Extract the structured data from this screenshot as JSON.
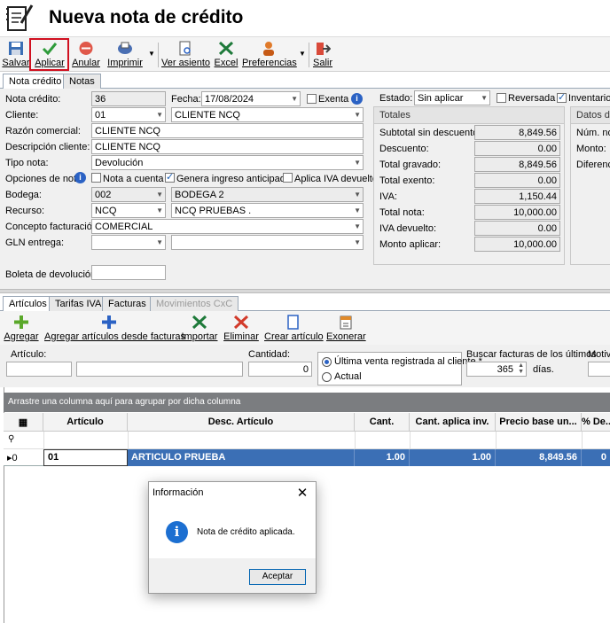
{
  "header": {
    "title": "Nueva nota de crédito",
    "icon": "notebook-edit-icon"
  },
  "toolbar": {
    "salvar": "Salvar",
    "aplicar": "Aplicar",
    "anular": "Anular",
    "imprimir": "Imprimir",
    "ver_asiento": "Ver asiento",
    "excel": "Excel",
    "preferencias": "Preferencias",
    "salir": "Salir"
  },
  "tabs": [
    "Nota crédito",
    "Notas"
  ],
  "form": {
    "nota_credito_label": "Nota crédito:",
    "nota_credito": "36",
    "fecha_label": "Fecha:",
    "fecha": "17/08/2024",
    "exenta_label": "Exenta",
    "cliente_label": "Cliente:",
    "cliente_code": "01",
    "cliente_name": "CLIENTE NCQ",
    "razon_label": "Razón comercial:",
    "razon": "CLIENTE NCQ",
    "descripcion_label": "Descripción cliente:",
    "descripcion": "CLIENTE NCQ",
    "tipo_label": "Tipo nota:",
    "tipo": "Devolución",
    "opciones_label": "Opciones de nota:",
    "nota_cuenta_label": "Nota a cuenta",
    "genera_label": "Genera ingreso anticipado",
    "aplica_iva_label": "Aplica IVA devuelto",
    "bodega_label": "Bodega:",
    "bodega_code": "002",
    "bodega_name": "BODEGA 2",
    "recurso_label": "Recurso:",
    "recurso_code": "NCQ",
    "recurso_name": "NCQ PRUEBAS .",
    "concepto_label": "Concepto facturación:",
    "concepto": "COMERCIAL",
    "gln_label": "GLN entrega:",
    "boleta_label": "Boleta de devolución:",
    "estado_label": "Estado:",
    "estado": "Sin aplicar",
    "reversada_label": "Reversada",
    "inventario_label": "Inventario a"
  },
  "totales": {
    "title": "Totales",
    "rows": [
      {
        "label": "Subtotal sin descuento:",
        "value": "8,849.56"
      },
      {
        "label": "Descuento:",
        "value": "0.00"
      },
      {
        "label": "Total gravado:",
        "value": "8,849.56"
      },
      {
        "label": "Total exento:",
        "value": "0.00"
      },
      {
        "label": "IVA:",
        "value": "1,150.44"
      },
      {
        "label": "Total nota:",
        "value": "10,000.00"
      },
      {
        "label": "IVA devuelto:",
        "value": "0.00"
      },
      {
        "label": "Monto aplicar:",
        "value": "10,000.00"
      }
    ]
  },
  "datos": {
    "title": "Datos de",
    "num": "Núm. not",
    "monto": "Monto:",
    "diferencia": "Diferencia"
  },
  "tabs2": [
    "Artículos",
    "Tarifas IVA",
    "Facturas",
    "Movimientos CxC"
  ],
  "toolbar2": {
    "agregar": "Agregar",
    "agregar_desde": "Agregar artículos desde facturas",
    "importar": "Importar",
    "eliminar": "Eliminar",
    "crear": "Crear artículo",
    "exonerar": "Exonerar"
  },
  "filters": {
    "articulo_label": "Artículo:",
    "cantidad_label": "Cantidad:",
    "cantidad": "0",
    "radio1": "Última venta registrada al cliente *",
    "radio2": "Actual",
    "buscar_label": "Buscar facturas  de los últimos",
    "buscar_dias": "365",
    "dias_label": "días.",
    "motivo_label": "Motivo"
  },
  "grid": {
    "group_hint": "Arrastre una columna aquí para agrupar por dicha columna",
    "columns": [
      "Artículo",
      "Desc. Artículo",
      "Cant.",
      "Cant. aplica inv.",
      "Precio base un...",
      "% De..."
    ],
    "row_index": "0",
    "row": [
      "01",
      "ARTICULO PRUEBA",
      "1.00",
      "1.00",
      "8,849.56",
      "0"
    ]
  },
  "dialog": {
    "title": "Información",
    "message": "Nota de crédito aplicada.",
    "button": "Aceptar",
    "close": "✕"
  }
}
